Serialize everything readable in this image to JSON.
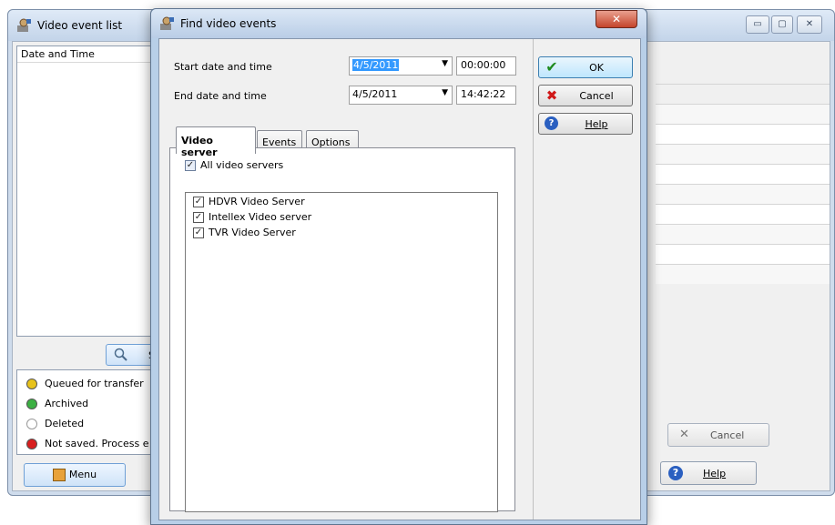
{
  "background_window": {
    "title": "Video event list",
    "column_header": "Date and Time",
    "search_label": "Se",
    "legend": [
      {
        "label": "Queued for transfer",
        "color": "#e7c21a"
      },
      {
        "label": "Archived",
        "color": "#3cb043"
      },
      {
        "label": "Deleted",
        "color": "#ffffff"
      },
      {
        "label": "Not saved. Process e",
        "color": "#d81e1e"
      }
    ],
    "menu_label": "Menu",
    "cancel_label": "Cancel",
    "help_label": "Help",
    "minimize_glyph": "▭",
    "maximize_glyph": "▢",
    "close_glyph": "✕"
  },
  "dialog": {
    "title": "Find video events",
    "close_glyph": "✕",
    "start_label": "Start date and time",
    "start_date": "4/5/2011",
    "start_time": "00:00:00",
    "end_label": "End date and time",
    "end_date": "4/5/2011",
    "end_time": "14:42:22",
    "ok_label": "OK",
    "cancel_label": "Cancel",
    "help_label": "Help",
    "tabs": [
      "Video server",
      "Events",
      "Options"
    ],
    "all_servers_label": "All video servers",
    "servers": [
      "HDVR Video Server",
      "Intellex Video server",
      "TVR Video Server"
    ]
  },
  "colors": {
    "ok_check": "#1e8a1e",
    "cancel_x": "#d01818",
    "help_circle": "#2a5fc0"
  }
}
